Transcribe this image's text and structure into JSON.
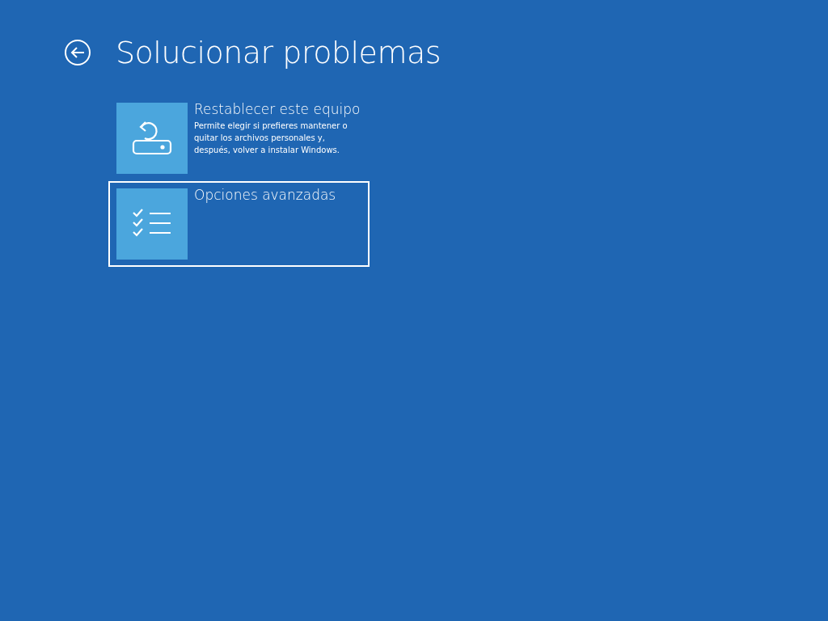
{
  "header": {
    "title": "Solucionar problemas"
  },
  "options": [
    {
      "kind": "reset",
      "title": "Restablecer este equipo",
      "description": "Permite elegir si prefieres mantener o quitar los archivos personales y, después, volver a instalar Windows.",
      "selected": false
    },
    {
      "kind": "advanced",
      "title": "Opciones avanzadas",
      "selected": true
    }
  ]
}
